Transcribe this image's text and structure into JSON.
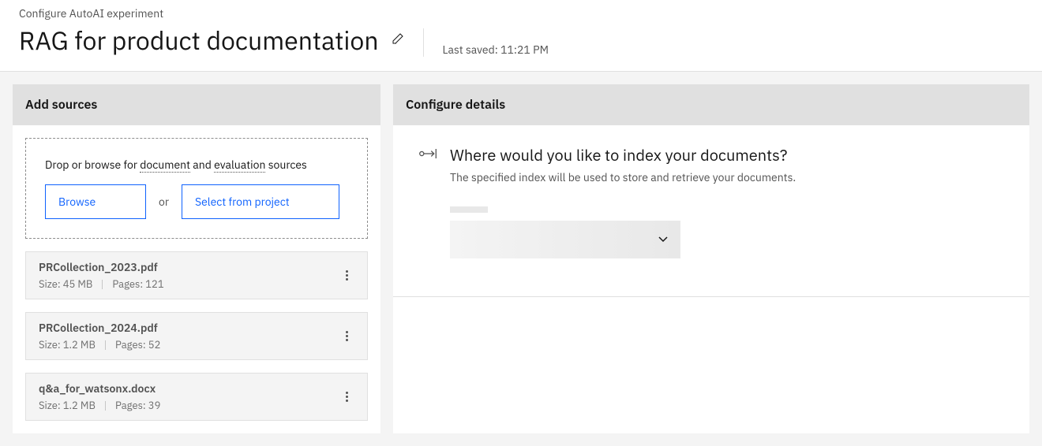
{
  "header": {
    "breadcrumb": "Configure AutoAI experiment",
    "title": "RAG for product documentation",
    "last_saved": "Last saved: 11:21 PM"
  },
  "sources": {
    "panel_title": "Add sources",
    "drop_text_prefix": "Drop or browse for ",
    "drop_text_doc": "document",
    "drop_text_and": " and ",
    "drop_text_eval": "evaluation",
    "drop_text_suffix": " sources",
    "browse_label": "Browse",
    "or_label": "or",
    "select_project_label": "Select from project",
    "files": [
      {
        "name": "PRCollection_2023.pdf",
        "size": "Size: 45 MB",
        "pages": "Pages: 121"
      },
      {
        "name": "PRCollection_2024.pdf",
        "size": "Size: 1.2 MB",
        "pages": "Pages: 52"
      },
      {
        "name": "q&a_for_watsonx.docx",
        "size": "Size: 1.2 MB",
        "pages": "Pages: 39"
      }
    ]
  },
  "config": {
    "panel_title": "Configure details",
    "question": "Where would you like to index your documents?",
    "description": "The specified index will be used to store and retrieve your documents."
  }
}
